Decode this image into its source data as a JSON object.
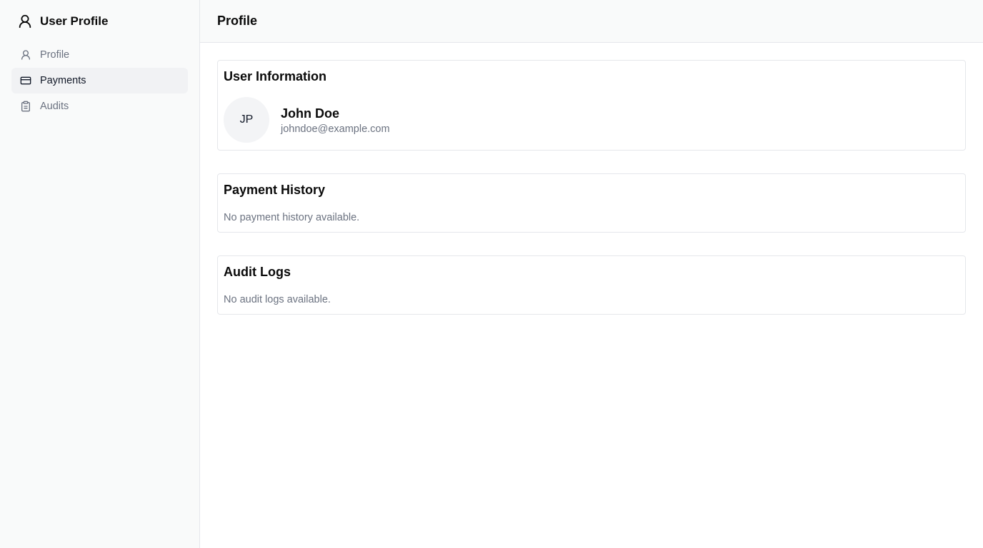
{
  "app": {
    "title": "User Profile",
    "icon": "user-icon"
  },
  "sidebar": {
    "items": [
      {
        "label": "Profile",
        "icon": "user-icon",
        "active": false
      },
      {
        "label": "Payments",
        "icon": "credit-card-icon",
        "active": true
      },
      {
        "label": "Audits",
        "icon": "clipboard-icon",
        "active": false
      }
    ]
  },
  "header": {
    "title": "Profile"
  },
  "user_info": {
    "title": "User Information",
    "initials": "JP",
    "name": "John Doe",
    "email": "johndoe@example.com"
  },
  "payment_history": {
    "title": "Payment History",
    "empty": "No payment history available."
  },
  "audit_logs": {
    "title": "Audit Logs",
    "empty": "No audit logs available."
  },
  "colors": {
    "sidebar_bg": "#f9fafa",
    "active_item_bg": "#f1f2f4",
    "muted_text": "#6b7280",
    "border": "#e5e7eb"
  }
}
